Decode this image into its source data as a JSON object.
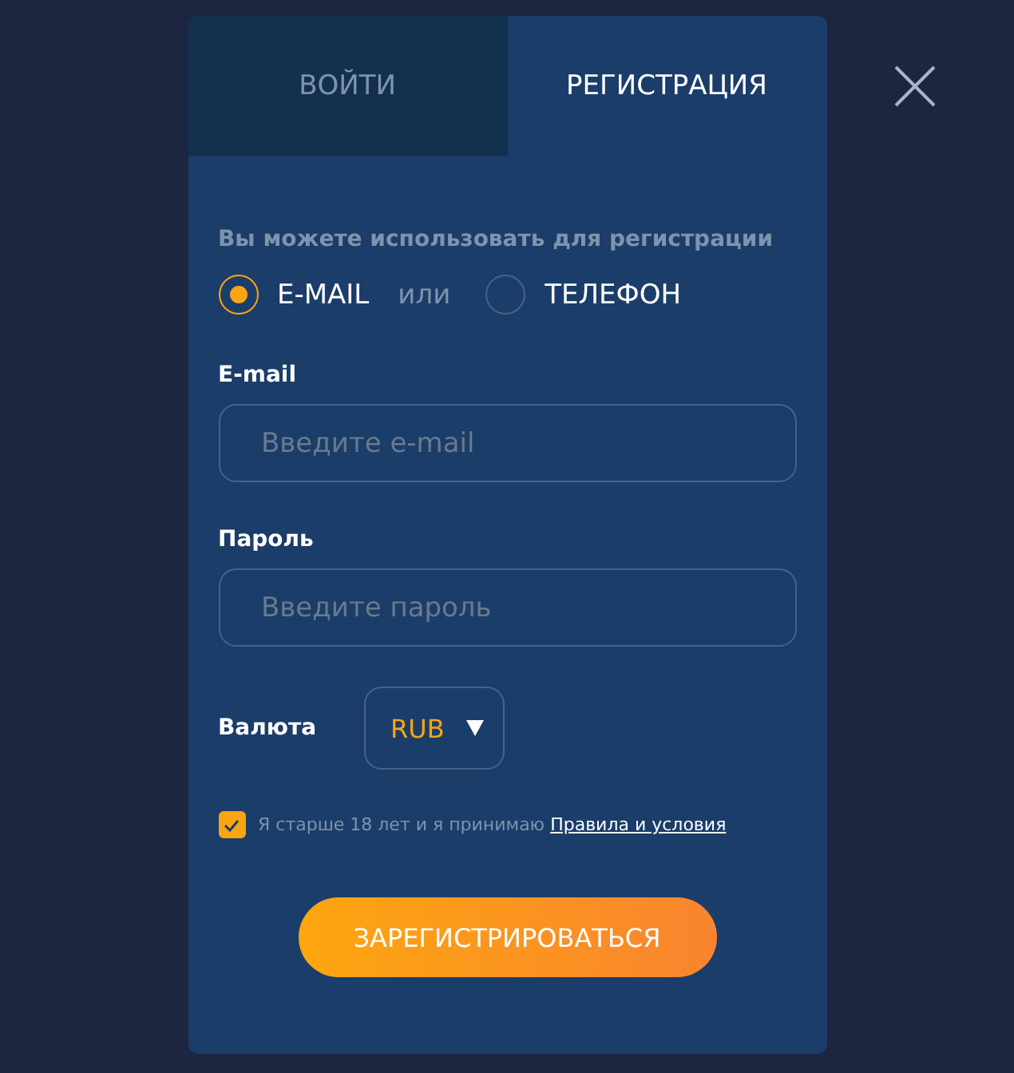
{
  "tabs": [
    {
      "label": "ВОЙТИ",
      "selected": false
    },
    {
      "label": "РЕГИСТРАЦИЯ",
      "selected": true
    }
  ],
  "method": {
    "prompt": "Вы можете использовать для регистрации",
    "separator": "или",
    "options": [
      {
        "label": "E-MAIL",
        "selected": true
      },
      {
        "label": "ТЕЛЕФОН",
        "selected": false
      }
    ]
  },
  "fields": [
    {
      "label": "E-mail",
      "placeholder": "Введите e-mail"
    },
    {
      "label": "Пароль",
      "placeholder": "Введите пароль"
    }
  ],
  "currency": {
    "label": "Валюта",
    "value": "RUB"
  },
  "terms": {
    "text": "Я старше 18 лет и я принимаю",
    "link": "Правила и условия",
    "checked": true
  },
  "submit": "ЗАРЕГИСТРИРОВАТЬСЯ"
}
